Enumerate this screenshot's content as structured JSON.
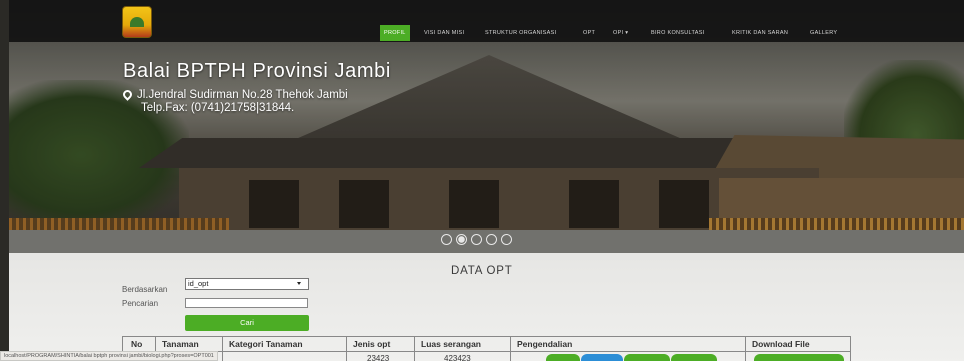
{
  "nav": {
    "items": [
      {
        "label": "PROFIL",
        "active": true
      },
      {
        "label": "VISI DAN MISI"
      },
      {
        "label": "STRUKTUR ORGANISASI"
      },
      {
        "label": "OPT"
      },
      {
        "label": "OPI ▾"
      },
      {
        "label": "BIRO KONSULTASI"
      },
      {
        "label": "KRITIK DAN SARAN"
      },
      {
        "label": "GALLERY"
      }
    ],
    "accent_color": "#4cad25"
  },
  "hero": {
    "title": "Balai BPTPH Provinsi Jambi",
    "address_line1": "Jl.Jendral Sudirman No.28 Thehok Jambi",
    "address_line2": "Telp.Fax: (0741)21758|31844.",
    "carousel_active_index": 1,
    "carousel_count": 5
  },
  "section": {
    "title": "DATA OPT",
    "filter_label": "Berdasarkan",
    "filter_value": "id_opt",
    "search_label": "Pencarian",
    "search_value": "",
    "search_button": "Cari"
  },
  "table": {
    "headers": [
      "No",
      "Tanaman",
      "Kategori Tanaman",
      "Jenis opt",
      "Luas serangan",
      "Pengendalian",
      "Download File"
    ],
    "rows": [
      {
        "no": "",
        "tanaman": "",
        "kategori": "",
        "jenis_opt": "23423",
        "luas": "423423"
      }
    ]
  },
  "status_url": "localhost/PROGRAM/SHINTIA/balai bptph provinsi jambi/biologi.php?proses=OPT001"
}
